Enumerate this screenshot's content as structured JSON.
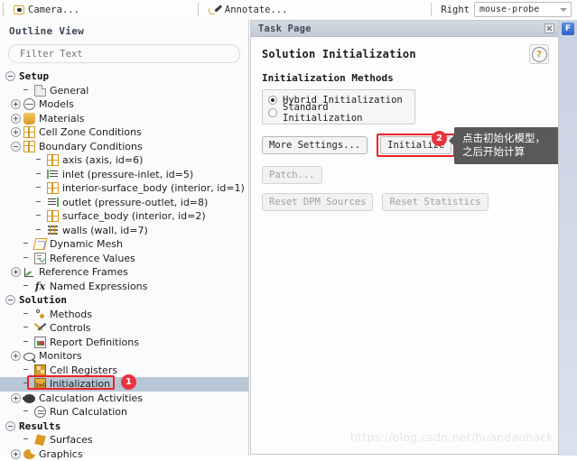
{
  "toolbar": {
    "camera_button": "Camera...",
    "annotate_button": "Annotate...",
    "right_label": "Right",
    "mouse_combo_value": "mouse-probe"
  },
  "outline": {
    "title": "Outline View",
    "filter_placeholder": "Filter Text",
    "filter_value": "",
    "tree": [
      {
        "label": "Setup",
        "depth": 0,
        "twist": "minus",
        "icon": "none",
        "root": true
      },
      {
        "label": "General",
        "depth": 2,
        "twist": "none",
        "icon": "general"
      },
      {
        "label": "Models",
        "depth": 1,
        "twist": "plus",
        "icon": "models"
      },
      {
        "label": "Materials",
        "depth": 1,
        "twist": "plus",
        "icon": "materials"
      },
      {
        "label": "Cell Zone Conditions",
        "depth": 1,
        "twist": "plus",
        "icon": "grid"
      },
      {
        "label": "Boundary Conditions",
        "depth": 1,
        "twist": "minus",
        "icon": "grid"
      },
      {
        "label": "axis (axis, id=6)",
        "depth": 3,
        "twist": "none",
        "icon": "grid"
      },
      {
        "label": "inlet (pressure-inlet, id=5)",
        "depth": 3,
        "twist": "none",
        "icon": "inlet"
      },
      {
        "label": "interior-surface_body (interior, id=1)",
        "depth": 3,
        "twist": "none",
        "icon": "grid"
      },
      {
        "label": "outlet (pressure-outlet, id=8)",
        "depth": 3,
        "twist": "none",
        "icon": "outlet"
      },
      {
        "label": "surface_body (interior, id=2)",
        "depth": 3,
        "twist": "none",
        "icon": "grid"
      },
      {
        "label": "walls (wall, id=7)",
        "depth": 3,
        "twist": "none",
        "icon": "walls"
      },
      {
        "label": "Dynamic Mesh",
        "depth": 2,
        "twist": "none",
        "icon": "dyn"
      },
      {
        "label": "Reference Values",
        "depth": 2,
        "twist": "none",
        "icon": "ref"
      },
      {
        "label": "Reference Frames",
        "depth": 1,
        "twist": "plus",
        "icon": "frames"
      },
      {
        "label": "Named Expressions",
        "depth": 2,
        "twist": "none",
        "icon": "fx"
      },
      {
        "label": "Solution",
        "depth": 0,
        "twist": "minus",
        "icon": "none",
        "root": true
      },
      {
        "label": "Methods",
        "depth": 2,
        "twist": "none",
        "icon": "meth"
      },
      {
        "label": "Controls",
        "depth": 2,
        "twist": "none",
        "icon": "ctrl"
      },
      {
        "label": "Report Definitions",
        "depth": 2,
        "twist": "none",
        "icon": "rdef"
      },
      {
        "label": "Monitors",
        "depth": 1,
        "twist": "plus",
        "icon": "mon"
      },
      {
        "label": "Cell Registers",
        "depth": 2,
        "twist": "none",
        "icon": "cellreg"
      },
      {
        "label": "Initialization",
        "depth": 2,
        "twist": "none",
        "icon": "init",
        "selected": true
      },
      {
        "label": "Calculation Activities",
        "depth": 1,
        "twist": "plus",
        "icon": "calc"
      },
      {
        "label": "Run Calculation",
        "depth": 2,
        "twist": "none",
        "icon": "run"
      },
      {
        "label": "Results",
        "depth": 0,
        "twist": "minus",
        "icon": "none",
        "root": true
      },
      {
        "label": "Surfaces",
        "depth": 2,
        "twist": "none",
        "icon": "surf"
      },
      {
        "label": "Graphics",
        "depth": 1,
        "twist": "plus",
        "icon": "graph"
      }
    ]
  },
  "task_page": {
    "panel_title": "Task Page",
    "heading": "Solution Initialization",
    "help_glyph": "?",
    "section_label": "Initialization Methods",
    "methods": [
      {
        "label": "Hybrid  Initialization",
        "selected": true
      },
      {
        "label": "Standard Initialization",
        "selected": false
      }
    ],
    "buttons": {
      "more_settings": "More Settings...",
      "initialize": "Initialize",
      "patch": "Patch...",
      "reset_dpm_sources": "Reset DPM Sources",
      "reset_statistics": "Reset Statistics"
    }
  },
  "annotations": {
    "badge_one": "1",
    "badge_two": "2",
    "tooltip_line1": "点击初始化模型，",
    "tooltip_line2": "之后开始计算"
  },
  "right_strip": {
    "button_glyph": "F"
  },
  "watermark": "https://blog.csdn.net/huandaohack"
}
